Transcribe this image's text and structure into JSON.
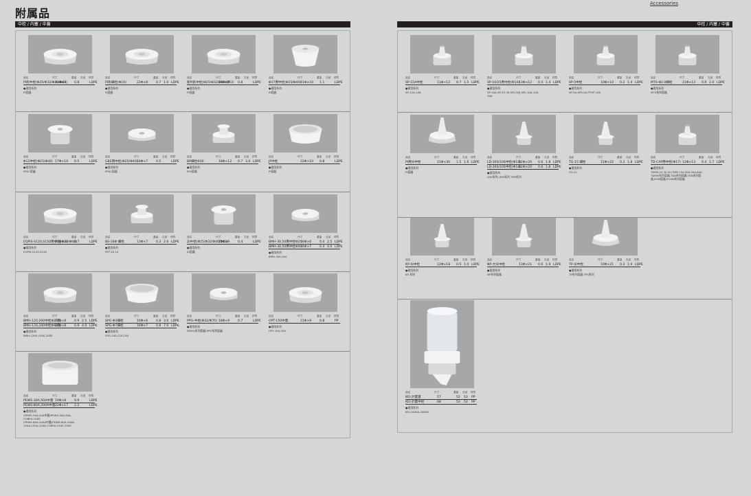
{
  "header": {
    "title": "附属品",
    "accessories_link": "Accessories"
  },
  "sections": {
    "left_bar": "中栓 / 内塞 / 中蓋",
    "right_bar": "中栓 / 内塞 / 中蓋"
  },
  "column_labels": {
    "name": "品名",
    "size": "尺寸",
    "weight": "重量",
    "count": "孔径",
    "material": "材質"
  },
  "left_products": [
    {
      "rows": [
        [
          "PI形中栓(Φ25/Φ32/Φ40/Φ63)",
          "21Φ×8",
          "0.8",
          "",
          "LDPE"
        ]
      ],
      "series_label": "●適用系列",
      "series": "PI容器",
      "shape": "disc"
    },
    {
      "rows": [
        [
          "PI形細栓(Φ10)",
          "22Φ×8",
          "0.7",
          "1.0",
          "LDPE"
        ]
      ],
      "series_label": "●適用系列",
      "series": "PI容器",
      "shape": "disc"
    },
    {
      "rows": [
        [
          "新PI形中栓(Φ25/Φ32/Φ40/Φ63)",
          "21Φ×7",
          "0.8",
          "",
          "LDPE"
        ]
      ],
      "series_label": "●適用系列",
      "series": "PI容器",
      "shape": "disc"
    },
    {
      "rows": [
        [
          "Φ17用中栓(Φ25/Φ40)",
          "21Φ×10",
          "1.1",
          "",
          "LDPE"
        ]
      ],
      "series_label": "●適用系列",
      "series": "PI容器",
      "shape": "cup"
    },
    {
      "rows": [
        [
          "Φ12中栓(Φ25/Φ40)",
          "17Φ×10",
          "0.5",
          "",
          "LDPE"
        ]
      ],
      "series_label": "●適用系列",
      "series": "PPSC容器",
      "shape": "plug"
    },
    {
      "rows": [
        [
          "GBE用中栓(Φ25/Φ40)",
          "18Φ×7",
          "0.5",
          "",
          "LDPE"
        ]
      ],
      "series_label": "●適用系列",
      "series": "PPSC容器",
      "shape": "flat"
    },
    {
      "rows": [
        [
          "BP細栓Φ30",
          "18Φ×12",
          "0.7",
          "3.0",
          "LDPE"
        ]
      ],
      "series_label": "●適用系列",
      "series": "PFS容器",
      "shape": "stepped"
    },
    {
      "rows": [
        [
          "JP中栓",
          "22Φ×10",
          "0.8",
          "",
          "LDPE"
        ]
      ],
      "series_label": "●適用系列",
      "series": "PI容器",
      "shape": "ring"
    },
    {
      "rows": [
        [
          "EQPIS-S120,S150用中栓(Φ32/Φ60)",
          "21Φ×10",
          "0.7",
          "",
          "LDPE"
        ]
      ],
      "series_label": "●適用系列",
      "series": "EQPIS-S120,S150",
      "shape": "disc"
    },
    {
      "rows": [
        [
          "BS-18Φ 細栓",
          "13Φ×7",
          "0.3",
          "2.6",
          "LDPE"
        ]
      ],
      "series_label": "●適用系列",
      "series": "PET-10,15",
      "shape": "stepped"
    },
    {
      "rows": [
        [
          "ZI中栓(Φ25/Φ32/Φ40/Φ63)",
          "15Φ×9",
          "0.4",
          "",
          "LDPE"
        ]
      ],
      "series_label": "●適用系列",
      "series": "ZI容器",
      "shape": "plug"
    },
    {
      "rows": [
        [
          "BMH-30,50用中栓Φ25",
          "16Φ×6",
          "0.4",
          "2.5",
          "LDPE"
        ],
        [
          "BMH-30,50用中栓Φ40",
          "16Φ×7",
          "0.4",
          "4.0",
          "LDPE"
        ]
      ],
      "series_label": "●適用系列",
      "series": "BMH-30S,50S",
      "shape": "flat"
    },
    {
      "rows": [
        [
          "BMH-120,200中栓Φ25孔",
          "21Φ×8",
          "0.9",
          "2.5",
          "LDPE"
        ],
        [
          "BMH-120,200中栓Φ40孔",
          "21Φ×8",
          "0.9",
          "4.0",
          "LDPE"
        ]
      ],
      "series_label": "●適用系列",
      "series": "BMH-120S,150S,200S",
      "shape": "disc"
    },
    {
      "rows": [
        [
          "SPG-Φ3細栓",
          "16Φ×6",
          "0.8",
          "3.0",
          "LDPE"
        ],
        [
          "SPG-Φ7細栓",
          "16Φ×7",
          "0.8",
          "7.0",
          "LDPE"
        ]
      ],
      "series_label": "●適用系列",
      "series": "SPG-100,120,150",
      "shape": "ring"
    },
    {
      "rows": [
        [
          "PPG-中栓(Φ32/Φ70)",
          "18Φ×9",
          "0.7",
          "",
          "LDPE"
        ]
      ],
      "series_label": "●適用系列",
      "series": "DMPG系列容器,PPG系列容器",
      "shape": "flat"
    },
    {
      "rows": [
        [
          "OPT-150中蓋",
          "21Φ×9",
          "0.8",
          "",
          "PP"
        ]
      ],
      "series_label": "●適用系列",
      "series": "OPT-150,200",
      "shape": "disc"
    },
    {
      "rows": [
        [
          "PEWS-30A,50A中蓋",
          "19Φ×8",
          "0.9",
          "",
          "LDPE"
        ],
        [
          "PEWS-80A,200A中蓋",
          "22Φ×17",
          "2.2",
          "",
          "LDPE"
        ]
      ],
      "series_label": "●適用系列",
      "series": "(PEWS-30A,50A中蓋)PEWS-30A,50A,\nCUBEA-100S\n(PEWS-80A,200A中蓋)PEWS-80A,100A,\n120A,150A,200A,CUBEA-150S,200S",
      "shape": "cap"
    }
  ],
  "right_products": [
    {
      "rows": [
        [
          "SP-15A中栓",
          "11Φ×12",
          "0.7",
          "1.5",
          "LDPE"
        ]
      ],
      "series_label": "●適用系列",
      "series": "SP-12A,15A",
      "shape": "nozzle"
    },
    {
      "rows": [
        [
          "SP-10/25用中栓(Φ14)",
          "13Φ×12",
          "0.4",
          "1.4",
          "LDPE"
        ]
      ],
      "series_label": "●適用系列",
      "series": "SP-10A,SP-25,30,SPII-30J,SPII-10A,15A,\n30A",
      "shape": "nozzle"
    },
    {
      "rows": [
        [
          "SP-5中栓",
          "10Φ×10",
          "0.2",
          "1.4",
          "LDPE"
        ]
      ],
      "series_label": "●適用系列",
      "series": "SP-5A,SPII-5A,PTHP-10S",
      "shape": "nozzle"
    },
    {
      "rows": [
        [
          "MTS-Φ2.0細栓",
          "21Φ×13",
          "0.9",
          "2.0",
          "LDPE"
        ]
      ],
      "series_label": "●適用系列",
      "series": "MTS系列容器",
      "shape": "nozzle"
    },
    {
      "rows": [
        [
          "PI用尖中栓",
          "21Φ×30",
          "1.5",
          "1.6",
          "LDPE"
        ]
      ],
      "series_label": "●適用系列",
      "series": "PI容器",
      "shape": "spike"
    },
    {
      "rows": [
        [
          "LD-30S/10S中栓(Φ18)",
          "12Φ×20",
          "0.6",
          "1.8",
          "LDPE"
        ],
        [
          "LD-30S/10S中栓(Φ18)",
          "12Φ×20",
          "0.6",
          "1.8",
          "LDPE"
        ]
      ],
      "series_label": "●適用系列",
      "series": "LDII系列,LDIII系列,TDP系列",
      "shape": "cone"
    },
    {
      "rows": [
        [
          "TG-15 細栓",
          "11Φ×22",
          "0.3",
          "1.8",
          "LDPE"
        ]
      ],
      "series_label": "●適用系列",
      "series": "TG-15",
      "shape": "cone"
    },
    {
      "rows": [
        [
          "TD-CAP用中栓(Φ17)",
          "12Φ×13",
          "0.4",
          "1.7",
          "LDPE"
        ]
      ],
      "series_label": "●適用系列",
      "series": "TDMII-15,30,50,TDM-15d,30d,50d,80d,\nTDMIII系列容器,TDA系列容器,TDB系列容\n器,EGM容器,EGMII系列容器",
      "shape": "nozzle"
    },
    {
      "rows": [
        [
          "KP-尖中栓",
          "12Φ×18",
          "0.5",
          "1.0",
          "LDPE"
        ]
      ],
      "series_label": "●適用系列",
      "series": "KP-系列",
      "shape": "cone"
    },
    {
      "rows": [
        [
          "NP-大尖中栓",
          "13Φ×21",
          "0.6",
          "1.9",
          "LDPE"
        ]
      ],
      "series_label": "●適用系列",
      "series": "NP系列容器",
      "shape": "cone"
    },
    {
      "rows": [
        [
          "TP-尖中栓",
          "10Φ×21",
          "0.3",
          "1.9",
          "LDPE"
        ]
      ],
      "series_label": "●適用系列",
      "series": "TP系列容器,TPS系列",
      "shape": "spike"
    },
    {
      "rows": [
        [
          "KEI-計量蓋",
          "57",
          "52",
          "53",
          "PP"
        ],
        [
          "KEI-計量中栓",
          "68",
          "53",
          "53",
          "PP"
        ]
      ],
      "series_label": "●適用系列",
      "series": "KEI-1000A,2000A",
      "shape": "measure"
    }
  ]
}
